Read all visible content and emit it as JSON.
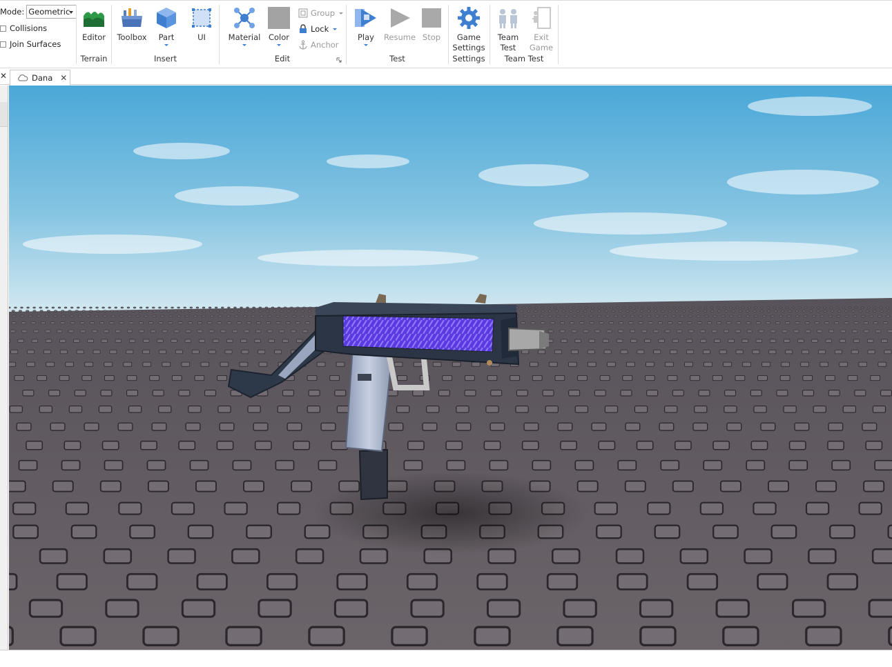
{
  "ribbon": {
    "mode_label": "Mode:",
    "mode_value": "Geometric",
    "collisions_label": "Collisions",
    "join_surfaces_label": "Join Surfaces",
    "terrain": {
      "editor_label": "Editor",
      "group_label": "Terrain"
    },
    "insert": {
      "toolbox_label": "Toolbox",
      "part_label": "Part",
      "ui_label": "UI",
      "group_label": "Insert"
    },
    "edit": {
      "material_label": "Material",
      "color_label": "Color",
      "group_item_label": "Group",
      "lock_label": "Lock",
      "anchor_label": "Anchor",
      "group_label": "Edit"
    },
    "test": {
      "play_label": "Play",
      "resume_label": "Resume",
      "stop_label": "Stop",
      "group_label": "Test"
    },
    "settings": {
      "game_settings_line1": "Game",
      "game_settings_line2": "Settings",
      "group_label": "Settings"
    },
    "team_test": {
      "team_test_line1": "Team",
      "team_test_line2": "Test",
      "exit_game_line1": "Exit",
      "exit_game_line2": "Game",
      "group_label": "Team Test"
    }
  },
  "tabs": {
    "doc_tab_label": "Dana",
    "close_glyph": "✕",
    "left_close_glyph": "✕"
  },
  "colors": {
    "accent": "#3f7fd0",
    "sky_top": "#4aa8d8",
    "sky_horizon": "#cfe6ef",
    "baseplate": "#5e5960",
    "gun_body": "#2f3a4a",
    "gun_panel": "#5b3be0",
    "grip": "#a9b4cc"
  }
}
